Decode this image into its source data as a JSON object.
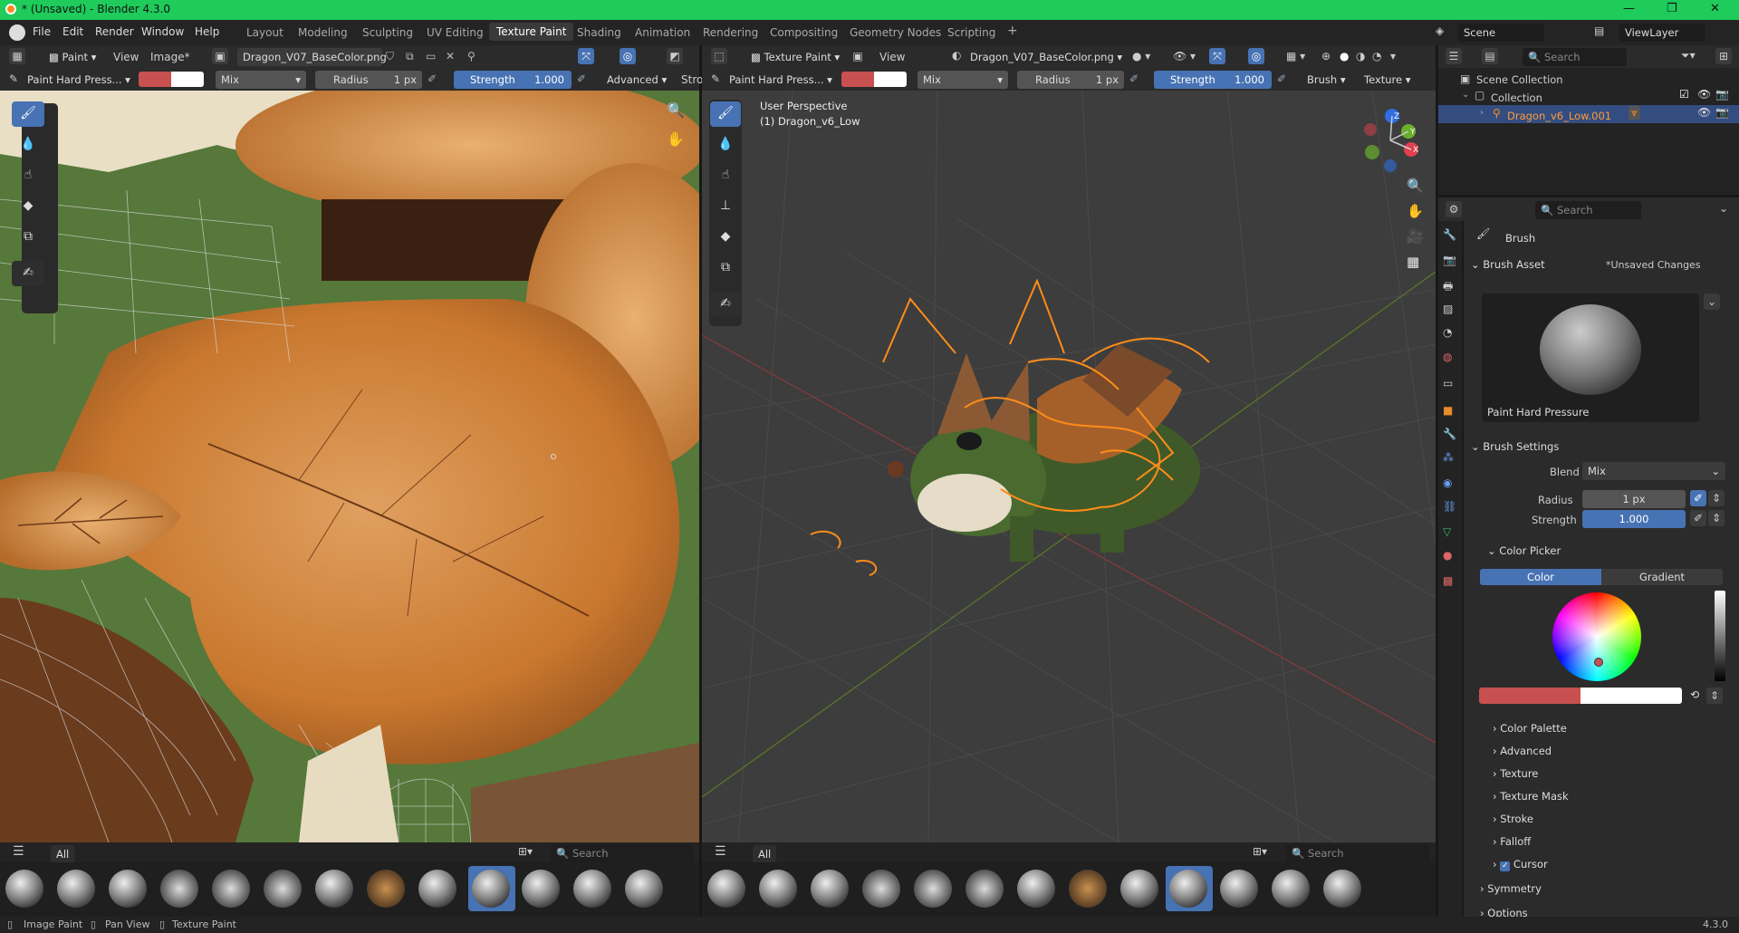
{
  "window": {
    "title": "* (Unsaved) - Blender 4.3.0",
    "version": "4.3.0"
  },
  "menus": [
    "File",
    "Edit",
    "Render",
    "Window",
    "Help"
  ],
  "workspaces": [
    "Layout",
    "Modeling",
    "Sculpting",
    "UV Editing",
    "Texture Paint",
    "Shading",
    "Animation",
    "Rendering",
    "Compositing",
    "Geometry Nodes",
    "Scripting"
  ],
  "active_workspace": "Texture Paint",
  "scene": {
    "name": "Scene",
    "view_layer": "ViewLayer"
  },
  "image_editor": {
    "mode": "Paint",
    "view": "View",
    "image_menu": "Image*",
    "image_name": "Dragon_V07_BaseColor.png",
    "brush": "Paint Hard Press...",
    "blend": "Mix",
    "radius_label": "Radius",
    "radius_value": "1 px",
    "strength_label": "Strength",
    "strength_value": "1.000",
    "advanced": "Advanced",
    "stroke": "Stro"
  },
  "viewport": {
    "mode": "Texture Paint",
    "view": "View",
    "image_name": "Dragon_V07_BaseColor.png",
    "brush": "Paint Hard Press...",
    "blend": "Mix",
    "radius_label": "Radius",
    "radius_value": "1 px",
    "strength_label": "Strength",
    "strength_value": "1.000",
    "brush_menu": "Brush",
    "texture_menu": "Texture",
    "overlay_line1": "User Perspective",
    "overlay_line2": "(1) Dragon_v6_Low",
    "gizmo": {
      "x": "X",
      "y": "Y",
      "z": "Z"
    }
  },
  "asset_shelf": {
    "filter": "All",
    "search_placeholder": "Search"
  },
  "outliner": {
    "search_placeholder": "Search",
    "scene_collection": "Scene Collection",
    "collection": "Collection",
    "object": "Dragon_v6_Low.001"
  },
  "properties": {
    "search_placeholder": "Search",
    "title": "Brush",
    "brush_asset": "Brush Asset",
    "unsaved": "*Unsaved Changes",
    "brush_name": "Paint Hard Pressure",
    "brush_settings": "Brush Settings",
    "blend_label": "Blend",
    "blend_value": "Mix",
    "radius_label": "Radius",
    "radius_value": "1 px",
    "strength_label": "Strength",
    "strength_value": "1.000",
    "color_picker": "Color Picker",
    "tab_color": "Color",
    "tab_gradient": "Gradient",
    "sections": [
      "Color Palette",
      "Advanced",
      "Texture",
      "Texture Mask",
      "Stroke",
      "Falloff",
      "Cursor"
    ],
    "symmetry": "Symmetry",
    "options": "Options"
  },
  "colors": {
    "primary": "#c85050",
    "secondary": "#ffffff",
    "accent": "#4772b3",
    "selected_orange": "#ff8c1a"
  },
  "statusbar": {
    "item1": "Image Paint",
    "item2": "Pan View",
    "item3": "Texture Paint",
    "version": "4.3.0"
  }
}
